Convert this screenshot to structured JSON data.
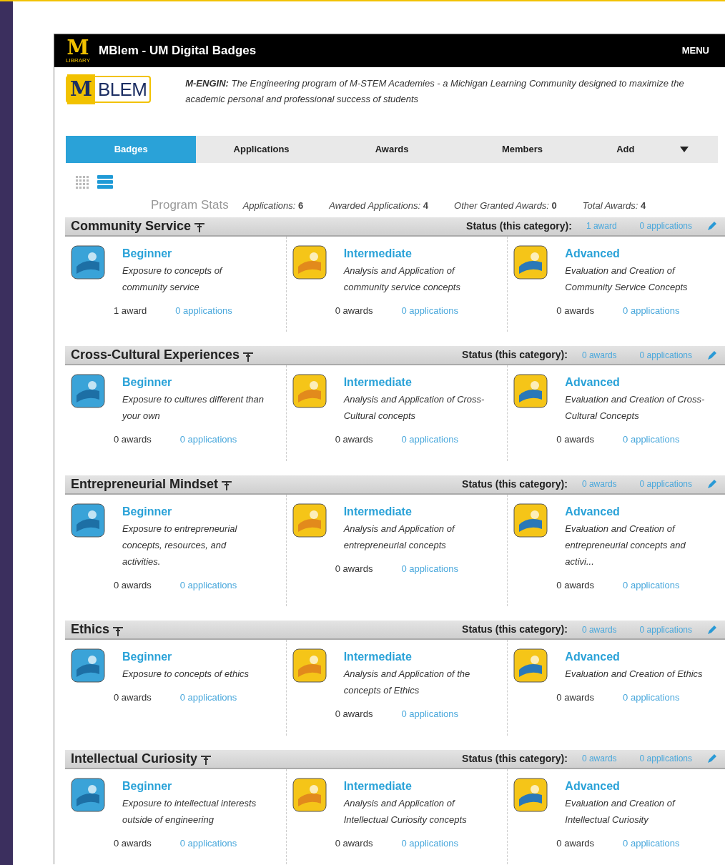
{
  "header": {
    "logo_letter": "M",
    "logo_caption": "LIBRARY",
    "title": "MBlem - UM Digital Badges",
    "menu": "MENU"
  },
  "brand": {
    "logo_letter": "M",
    "logo_word": "BLEM"
  },
  "description": "**M-ENGIN:** The Engineering program of M-STEM Academies - a Michigan Learning Community designed to maximize the academic personal and professional success of students",
  "tabs": [
    {
      "label": "Badges",
      "selected": true
    },
    {
      "label": "Applications",
      "selected": false
    },
    {
      "label": "Awards",
      "selected": false
    },
    {
      "label": "Members",
      "selected": false
    },
    {
      "label": "Add",
      "selected": false,
      "dropdown": true
    }
  ],
  "view_modes": [
    {
      "kind": "grid",
      "selected": false
    },
    {
      "kind": "list",
      "selected": true
    }
  ],
  "program_stats": {
    "label": "Program Stats",
    "items": [
      {
        "label": "Applications:",
        "value": "6"
      },
      {
        "label": "Awarded Applications:",
        "value": "4"
      },
      {
        "label": "Other Granted Awards:",
        "value": "0"
      },
      {
        "label": "Total Awards:",
        "value": "4"
      }
    ]
  },
  "categories": [
    {
      "name": "Community Service",
      "status_label": "Status (this category):",
      "status_awards": "1 award",
      "status_applications": "0 applications",
      "badges": [
        {
          "level": "Beginner",
          "description": "Exposure to concepts of community service",
          "awards": "1 award",
          "applications": "0 applications"
        },
        {
          "level": "Intermediate",
          "description": "Analysis and Application of community service concepts",
          "awards": "0 awards",
          "applications": "0 applications"
        },
        {
          "level": "Advanced",
          "description": "Evaluation and Creation of Community Service Concepts",
          "awards": "0 awards",
          "applications": "0 applications"
        }
      ]
    },
    {
      "name": "Cross-Cultural Experiences",
      "status_label": "Status (this category):",
      "status_awards": "0 awards",
      "status_applications": "0 applications",
      "badges": [
        {
          "level": "Beginner",
          "description": "Exposure to cultures different than your own",
          "awards": "0 awards",
          "applications": "0 applications"
        },
        {
          "level": "Intermediate",
          "description": "Analysis and Application of Cross-Cultural concepts",
          "awards": "0 awards",
          "applications": "0 applications"
        },
        {
          "level": "Advanced",
          "description": "Evaluation and Creation of Cross-Cultural Concepts",
          "awards": "0 awards",
          "applications": "0 applications"
        }
      ]
    },
    {
      "name": "Entrepreneurial Mindset",
      "status_label": "Status (this category):",
      "status_awards": "0 awards",
      "status_applications": "0 applications",
      "badges": [
        {
          "level": "Beginner",
          "description": "Exposure to entrepreneurial concepts, resources, and activities.",
          "awards": "0 awards",
          "applications": "0 applications"
        },
        {
          "level": "Intermediate",
          "description": "Analysis and Application of entrepreneurial concepts",
          "awards": "0 awards",
          "applications": "0 applications"
        },
        {
          "level": "Advanced",
          "description": "Evaluation and Creation of entrepreneurial concepts and activi...",
          "awards": "0 awards",
          "applications": "0 applications"
        }
      ]
    },
    {
      "name": "Ethics",
      "status_label": "Status (this category):",
      "status_awards": "0 awards",
      "status_applications": "0 applications",
      "badges": [
        {
          "level": "Beginner",
          "description": "Exposure to concepts of ethics",
          "awards": "0 awards",
          "applications": "0 applications"
        },
        {
          "level": "Intermediate",
          "description": "Analysis and Application of the concepts of Ethics",
          "awards": "0 awards",
          "applications": "0 applications"
        },
        {
          "level": "Advanced",
          "description": "Evaluation and Creation of Ethics",
          "awards": "0 awards",
          "applications": "0 applications"
        }
      ]
    },
    {
      "name": "Intellectual Curiosity",
      "status_label": "Status (this category):",
      "status_awards": "0 awards",
      "status_applications": "0 applications",
      "badges": [
        {
          "level": "Beginner",
          "description": "Exposure to intellectual interests outside of engineering",
          "awards": "0 awards",
          "applications": "0 applications"
        },
        {
          "level": "Intermediate",
          "description": "Analysis and Application of Intellectual Curiosity concepts",
          "awards": "0 awards",
          "applications": "0 applications"
        },
        {
          "level": "Advanced",
          "description": "Evaluation and Creation of Intellectual Curiosity",
          "awards": "0 awards",
          "applications": "0 applications"
        }
      ]
    }
  ]
}
